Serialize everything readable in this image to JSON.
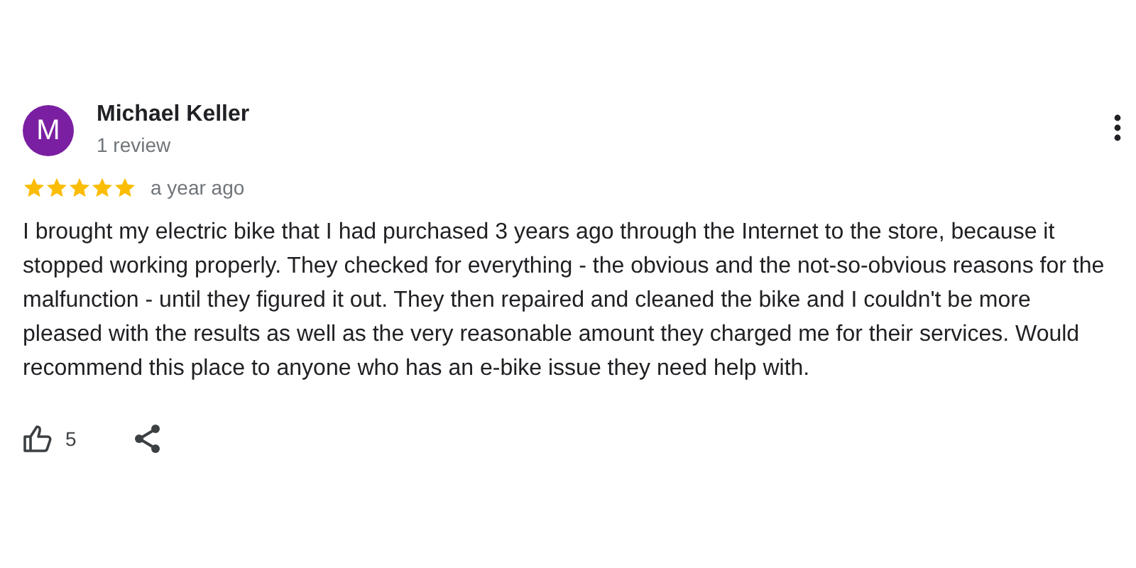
{
  "review": {
    "avatar": {
      "letter": "M",
      "color": "#7b1fa2"
    },
    "author": "Michael Keller",
    "author_meta": "1 review",
    "stars": 5,
    "time": "a year ago",
    "text": "I brought my electric bike that I had purchased 3 years ago through the Internet to the store, because it stopped working properly. They checked for everything - the obvious and the not-so-obvious reasons for the malfunction - until they figured it out. They then repaired and cleaned the bike and I couldn't be more pleased with the results as well as the very reasonable amount they charged me for their services. Would recommend this place to anyone who has an e-bike issue they need help with.",
    "likes": "5"
  }
}
